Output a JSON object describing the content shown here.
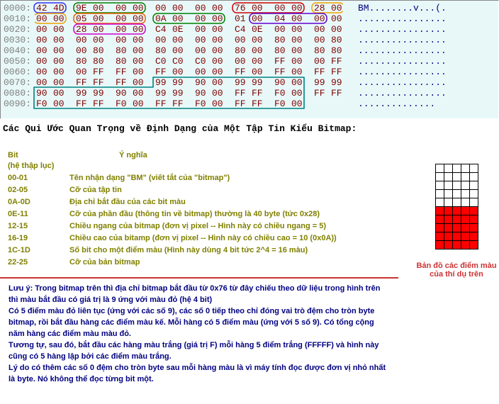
{
  "hexdump": {
    "offsets": [
      "0000:",
      "0010:",
      "0020:",
      "0030:",
      "0040:",
      "0050:",
      "0060:",
      "0070:",
      "0080:",
      "0090:"
    ],
    "rows": [
      [
        "42",
        "4D",
        "9E",
        "00",
        "00",
        "00",
        "00",
        "00",
        "00",
        "00",
        "76",
        "00",
        "00",
        "00",
        "28",
        "00"
      ],
      [
        "00",
        "00",
        "05",
        "00",
        "00",
        "00",
        "0A",
        "00",
        "00",
        "00",
        "01",
        "00",
        "04",
        "00",
        "00",
        "00"
      ],
      [
        "00",
        "00",
        "28",
        "00",
        "00",
        "00",
        "C4",
        "0E",
        "00",
        "00",
        "C4",
        "0E",
        "00",
        "00",
        "00",
        "00"
      ],
      [
        "00",
        "00",
        "00",
        "00",
        "00",
        "00",
        "00",
        "00",
        "00",
        "00",
        "00",
        "00",
        "80",
        "00",
        "00",
        "80"
      ],
      [
        "00",
        "00",
        "00",
        "80",
        "80",
        "00",
        "80",
        "00",
        "00",
        "00",
        "80",
        "00",
        "80",
        "00",
        "80",
        "80"
      ],
      [
        "00",
        "00",
        "80",
        "80",
        "80",
        "00",
        "C0",
        "C0",
        "C0",
        "00",
        "00",
        "00",
        "FF",
        "00",
        "00",
        "FF"
      ],
      [
        "00",
        "00",
        "00",
        "FF",
        "FF",
        "00",
        "FF",
        "00",
        "00",
        "00",
        "FF",
        "00",
        "FF",
        "00",
        "FF",
        "FF"
      ],
      [
        "00",
        "00",
        "FF",
        "FF",
        "FF",
        "00",
        "99",
        "99",
        "90",
        "00",
        "99",
        "99",
        "90",
        "00",
        "99",
        "99"
      ],
      [
        "90",
        "00",
        "99",
        "99",
        "90",
        "00",
        "99",
        "99",
        "90",
        "00",
        "FF",
        "FF",
        "F0",
        "00",
        "FF",
        "FF"
      ],
      [
        "F0",
        "00",
        "FF",
        "FF",
        "F0",
        "00",
        "FF",
        "FF",
        "F0",
        "00",
        "FF",
        "FF",
        "F0",
        "00",
        ".",
        "."
      ]
    ],
    "ascii": [
      "BM........v...(.",
      "................",
      "................",
      "................",
      "................",
      "................",
      "................",
      "................",
      "................",
      ".............."
    ],
    "highlights": [
      {
        "row": 0,
        "start": 0,
        "end": 1,
        "color": "#3030f0",
        "fill": "none"
      },
      {
        "row": 0,
        "start": 2,
        "end": 5,
        "color": "#008000",
        "fill": "none"
      },
      {
        "row": 0,
        "start": 10,
        "end": 13,
        "color": "#d00000",
        "fill": "none"
      },
      {
        "row": 0,
        "start": 14,
        "end": 15,
        "color": "#f0a000",
        "fill": "none",
        "open": "right"
      },
      {
        "row": 1,
        "start": 0,
        "end": 1,
        "color": "#f0a000",
        "fill": "none",
        "open": "left"
      },
      {
        "row": 1,
        "start": 2,
        "end": 5,
        "color": "#f06000",
        "fill": "none"
      },
      {
        "row": 1,
        "start": 6,
        "end": 9,
        "color": "#008000",
        "fill": "none"
      },
      {
        "row": 1,
        "start": 11,
        "end": 14,
        "color": "#6000d0",
        "fill": "none"
      },
      {
        "row": 2,
        "start": 2,
        "end": 5,
        "color": "#d000d0",
        "fill": "none"
      }
    ],
    "bigbox": {
      "fromRow": 7,
      "fromCol": 6,
      "toRow": 9,
      "toCol": 13,
      "color": "#008080"
    }
  },
  "caption": "Các Qui Ước Quan Trọng về Định Dạng của Một Tập Tin Kiểu Bitmap:",
  "fields": {
    "head_bit": "Bit",
    "head_sys": "(hệ thập lục)",
    "head_meaning": "Ý nghĩa",
    "items": [
      {
        "bit": "00-01",
        "text": "Tên nhận dạng \"BM\" (viết tắt của \"bitmap\")"
      },
      {
        "bit": "02-05",
        "text": "Cỡ của tập tin"
      },
      {
        "bit": "0A-0D",
        "text": "Địa chỉ bắt đầu của các bit màu"
      },
      {
        "bit": "0E-11",
        "text": "Cỡ của phần đầu (thông tin về bitmap) thường là 40 byte (tức 0x28)"
      },
      {
        "bit": "12-15",
        "text": "Chiều ngang của bitmap (đơn vị pixel -- Hình này có chiều ngang = 5)"
      },
      {
        "bit": "16-19",
        "text": "Chiều cao của bitamp (đơn vị pixel -- Hình này có chiều cao = 10 (0x0A))"
      },
      {
        "bit": "1C-1D",
        "text": "Số bit cho một điểm màu (Hình này dùng 4 bit tức 2^4 = 16 màu)"
      },
      {
        "bit": "22-25",
        "text": "Cỡ của bản bitmap"
      }
    ]
  },
  "bmp": {
    "rows": 10,
    "cols": 5,
    "red_rows_from_bottom": 5,
    "label": "Bản đồ các điểm màu của thí dụ trên"
  },
  "notes": [
    "Lưu ý:  Trong bitmap trên thì địa chỉ bitmap bắt đầu từ 0x76 từ đây chiếu theo dữ liệu trong hình trên thì màu bắt đầu có giá trị là  9 ứng với màu đỏ (hệ 4 bit)",
    "Có 5 điểm màu đỏ liên tục (ứng với các số 9), các số 0 tiếp theo chỉ đóng vai trò đệm cho tròn byte bitmap, rồi bắt đầu hàng các điểm màu kế. Mỗi hàng có 5 điểm màu (ứng với 5 số 9). Có tổng cộng năm hàng các điểm màu màu đỏ.",
    "Tương tự, sau đó, bắt đầu các hàng màu trắng (giá trị F) mỗi hàng 5 điểm trắng (FFFFF) và hình này cũng có 5 hàng lập bởi các điểm màu trắng.",
    "Lý do có thêm các số 0 đệm cho tròn byte sau mỗi hàng màu là vì máy tính đọc được đơn vị nhỏ nhất là byte.  Nó không thể đọc từng bit một."
  ]
}
